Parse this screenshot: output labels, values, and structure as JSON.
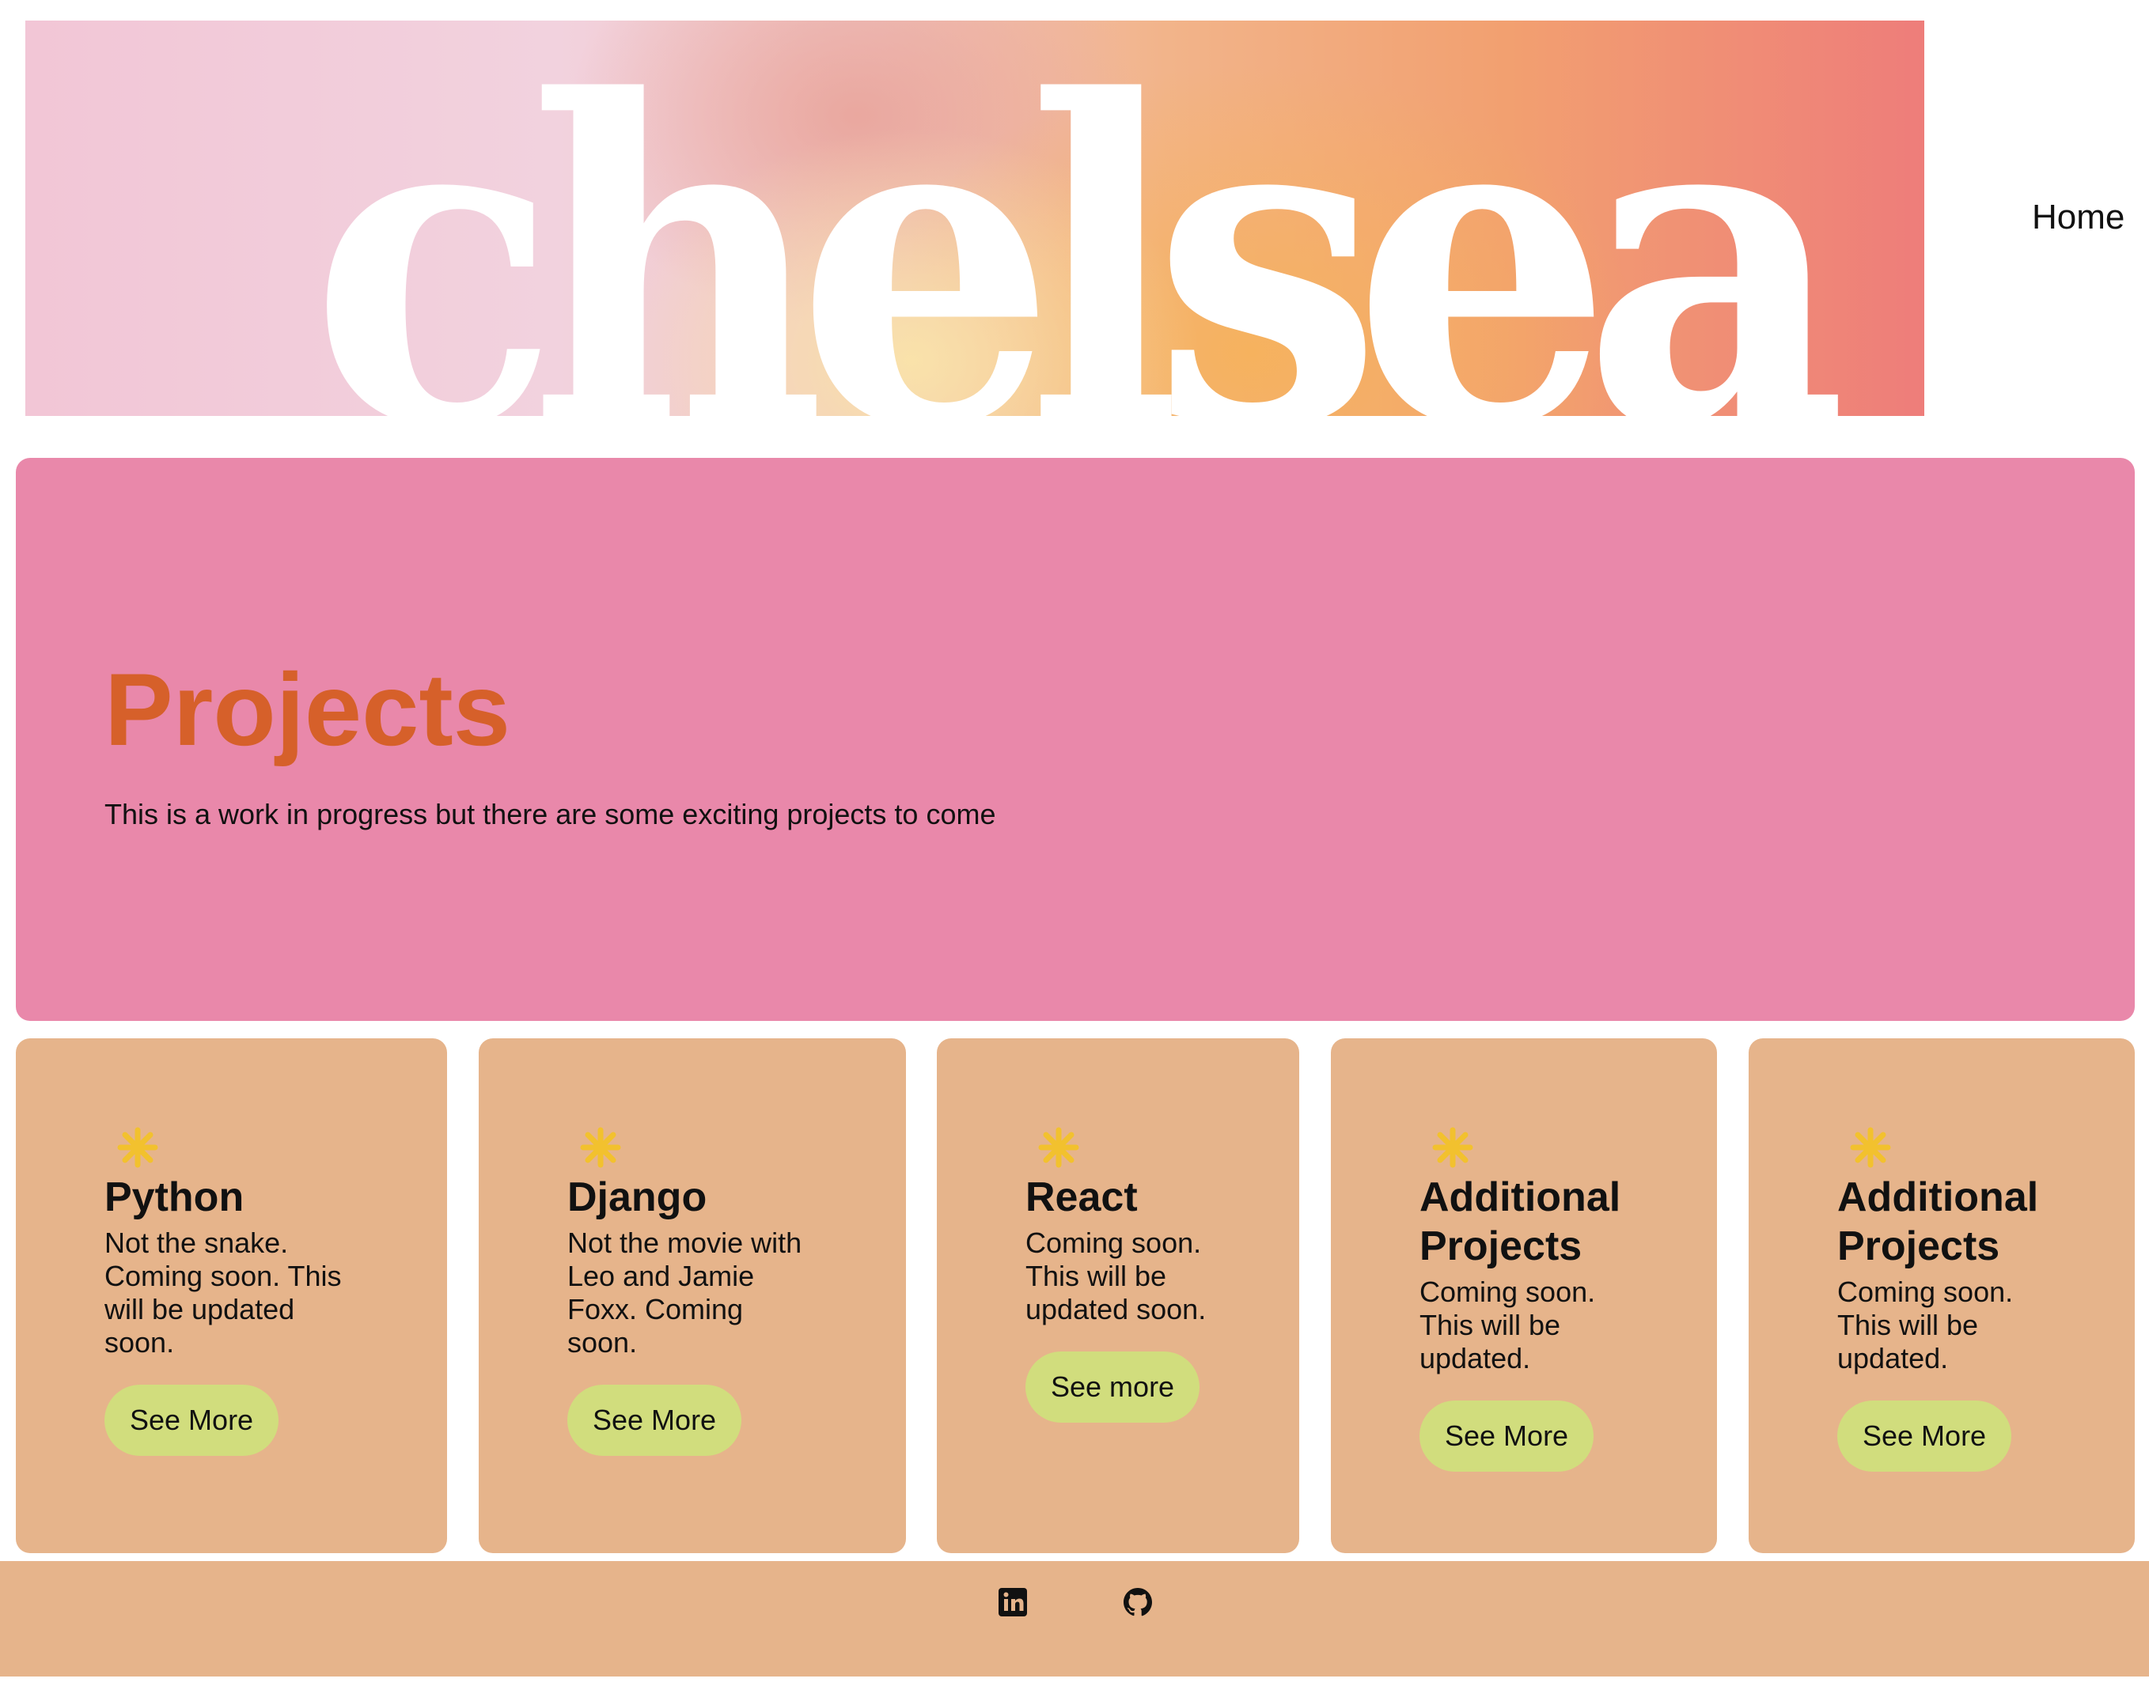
{
  "header": {
    "banner_word": "chelsea",
    "nav_home": "Home"
  },
  "hero": {
    "title": "Projects",
    "text": "This is a work in progress but there are some exciting projects to come"
  },
  "cards": [
    {
      "title": "Python",
      "text": "Not the snake. Coming soon. This will be updated soon.",
      "button": "See More",
      "icon": "sparkle-icon"
    },
    {
      "title": "Django",
      "text": "Not the movie with Leo and Jamie Foxx. Coming soon.",
      "button": "See More",
      "icon": "sparkle-icon"
    },
    {
      "title": "React",
      "text": "Coming soon. This will be updated soon.",
      "button": "See more",
      "icon": "sparkle-icon"
    },
    {
      "title": "Additional Projects",
      "text": "Coming soon. This will be updated.",
      "button": "See More",
      "icon": "sparkle-icon"
    },
    {
      "title": "Additional Projects",
      "text": "Coming soon. This will be updated.",
      "button": "See More",
      "icon": "sparkle-icon"
    }
  ],
  "footer": {
    "icons": [
      "linkedin-icon",
      "github-icon"
    ]
  },
  "colors": {
    "hero_bg": "#e988aa",
    "hero_title": "#d6602a",
    "card_bg": "#e6b48b",
    "button_bg": "#d1dd7d",
    "sparkle": "#f2c12e"
  }
}
